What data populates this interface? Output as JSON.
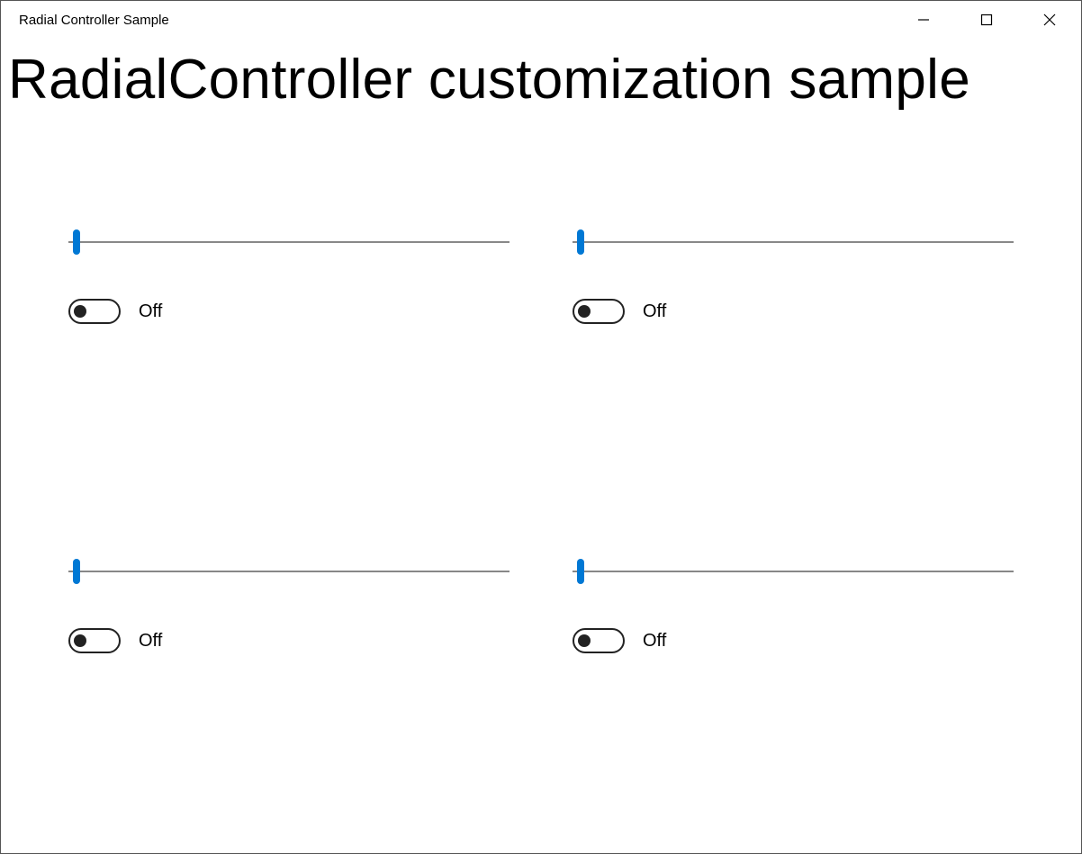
{
  "window": {
    "title": "Radial Controller Sample"
  },
  "page": {
    "heading": "RadialController customization sample"
  },
  "controls": [
    {
      "slider_value": 0,
      "toggle_on": false,
      "toggle_label": "Off"
    },
    {
      "slider_value": 0,
      "toggle_on": false,
      "toggle_label": "Off"
    },
    {
      "slider_value": 0,
      "toggle_on": false,
      "toggle_label": "Off"
    },
    {
      "slider_value": 0,
      "toggle_on": false,
      "toggle_label": "Off"
    }
  ],
  "colors": {
    "accent": "#0078D4",
    "track": "#888888",
    "toggle_border": "#222222"
  }
}
